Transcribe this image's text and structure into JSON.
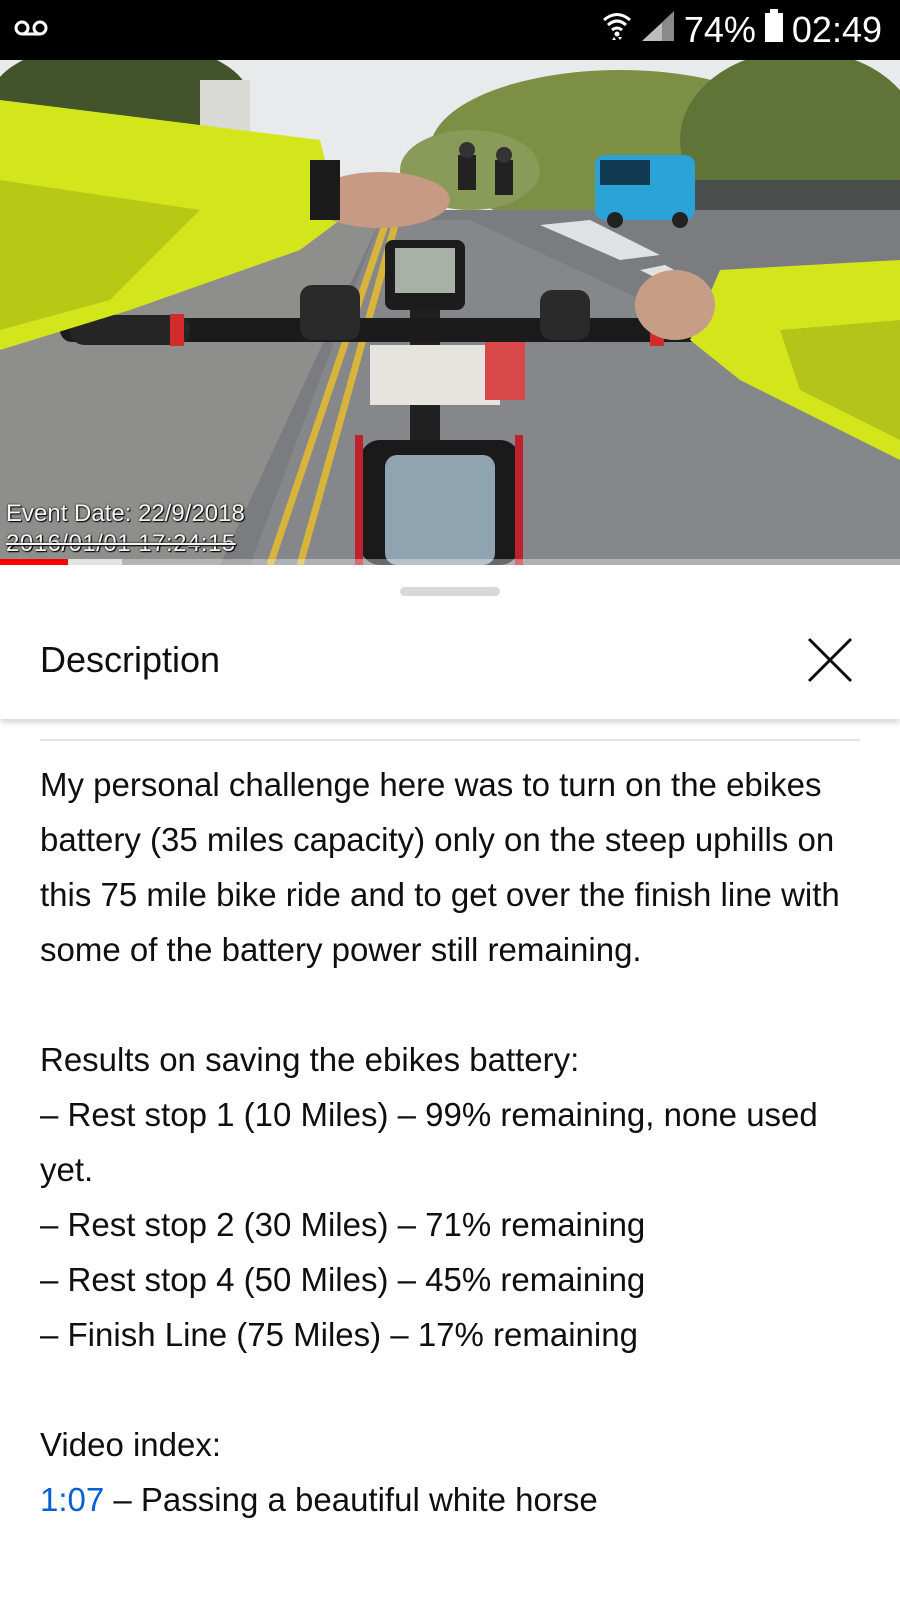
{
  "status_bar": {
    "battery_percent": "74%",
    "time": "02:49",
    "icons": [
      "voicemail-icon",
      "wifi-icon",
      "signal-icon",
      "battery-icon"
    ]
  },
  "video": {
    "overlay_event_date": "Event Date: 22/9/2018",
    "overlay_timestamp": "2016/01/01 17:24:15",
    "progress_played": 0.075,
    "progress_buffered": 0.135,
    "accent_color": "#ff0000"
  },
  "sheet": {
    "title": "Description",
    "close_icon": "close-icon"
  },
  "description": {
    "intro": "My personal challenge here was to turn on the ebikes battery (35 miles capacity) only on the steep uphills on this 75 mile bike ride and to get over the finish line with some of the battery power still remaining.",
    "results_heading": "Results on saving the ebikes battery:",
    "results": [
      "– Rest stop 1 (10 Miles) – 99% remaining, none used yet.",
      "– Rest stop 2 (30 Miles) – 71% remaining",
      "– Rest stop 4 (50 Miles) – 45% remaining",
      "– Finish Line (75 Miles) – 17% remaining"
    ],
    "index_heading": "Video index:",
    "index": [
      {
        "time": "1:07",
        "text": " – Passing a beautiful white horse"
      }
    ],
    "link_color": "#065fd4"
  }
}
